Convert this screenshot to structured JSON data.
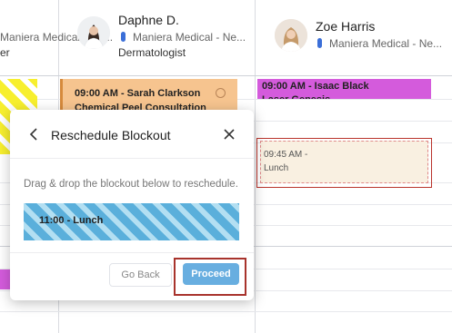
{
  "columns": [
    {
      "name": "",
      "location": "Maniera Medical - Ne...",
      "specialty": "er"
    },
    {
      "name": "Daphne D.",
      "location": "Maniera Medical - Ne...",
      "specialty": "Dermatologist"
    },
    {
      "name": "Zoe Harris",
      "location": "Maniera Medical - Ne...",
      "specialty": ""
    }
  ],
  "appointments": {
    "daphne_time": "09:00 AM - Sarah Clarkson",
    "daphne_service": "Chemical Peel Consultation",
    "zoe_time": "09:00 AM - Isaac Black",
    "zoe_service": "Laser Genesis"
  },
  "drop_target": {
    "time": "09:45 AM -",
    "label": "Lunch"
  },
  "modal": {
    "title": "Reschedule Blockout",
    "instruction": "Drag & drop the blockout below to reschedule.",
    "blockout_label": "11:00 - Lunch",
    "back_button": "Go Back",
    "proceed_button": "Proceed"
  },
  "colors": {
    "daphne_appt": "#f6c48f",
    "zoe_appt": "#d45bdc",
    "blockout_stripe": "#5aafdb",
    "proceed_button": "#68aee0",
    "focus_outline": "#a8332c"
  }
}
